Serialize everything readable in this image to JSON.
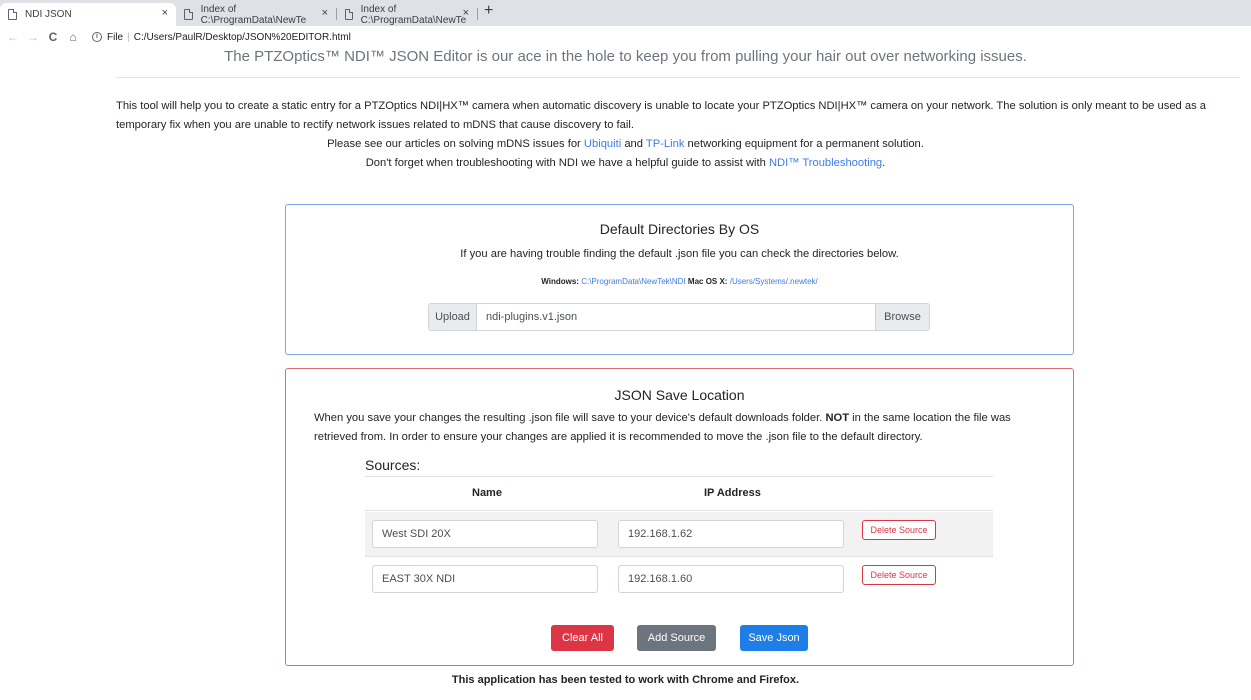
{
  "browser": {
    "tabs": [
      {
        "title": "NDI JSON"
      },
      {
        "title": "Index of C:\\ProgramData\\NewTe"
      },
      {
        "title": "Index of C:\\ProgramData\\NewTe"
      }
    ],
    "close_glyph": "×",
    "new_tab_glyph": "+",
    "back_glyph": "←",
    "forward_glyph": "→",
    "reload_glyph": "C",
    "home_glyph": "⌂",
    "info_glyph": "i",
    "url_scheme": "File",
    "url": "C:/Users/PaulR/Desktop/JSON%20EDITOR.html"
  },
  "page": {
    "tagline": "The PTZOptics™ NDI™ JSON Editor is our ace in the hole to keep you from pulling your hair out over networking issues.",
    "intro": "This tool will help you to create a static entry for a PTZOptics NDI|HX™ camera when automatic discovery is unable to locate your PTZOptics NDI|HX™ camera on your network. The solution is only meant to be used as a temporary fix when you are unable to rectify network issues related to mDNS that cause discovery to fail.",
    "articles_prefix": "Please see our articles on solving mDNS issues for ",
    "articles_link1": "Ubiquiti",
    "articles_and": " and ",
    "articles_link2": "TP-Link",
    "articles_suffix": " networking equipment for a permanent solution.",
    "troubleshoot_prefix": "Don't forget when troubleshooting with NDI we have a helpful guide to assist with ",
    "troubleshoot_link": "NDI™ Troubleshooting",
    "troubleshoot_suffix": "."
  },
  "directories": {
    "title": "Default Directories By OS",
    "subtitle": "If you are having trouble finding the default .json file you can check the directories below.",
    "windows_label": "Windows:",
    "windows_path": "C:\\ProgramData\\NewTek\\NDI",
    "mac_label": "Mac OS X:",
    "mac_path": "/Users/Systems/.newtek/",
    "upload_label": "Upload",
    "upload_value": "ndi-plugins.v1.json",
    "browse_label": "Browse"
  },
  "save": {
    "title": "JSON Save Location",
    "desc_part1": "When you save your changes the resulting .json file will save to your device's default downloads folder. ",
    "desc_bold": "NOT",
    "desc_part2": " in the same location the file was retrieved from. In order to ensure your changes are applied it is recommended to move the .json file to the default directory.",
    "sources_title": "Sources:",
    "col_name": "Name",
    "col_ip": "IP Address",
    "rows": [
      {
        "name": "West SDI 20X",
        "ip": "192.168.1.62",
        "delete": "Delete Source"
      },
      {
        "name": "EAST 30X NDI",
        "ip": "192.168.1.60",
        "delete": "Delete Source"
      }
    ],
    "clear_label": "Clear All",
    "add_label": "Add Source",
    "save_label": "Save Json"
  },
  "footer": "This application has been tested to work with Chrome and Firefox.",
  "colors": {
    "link": "#3d7ce6",
    "danger": "#dc3545",
    "secondary": "#6c757d",
    "primary": "#1e7ee8"
  }
}
